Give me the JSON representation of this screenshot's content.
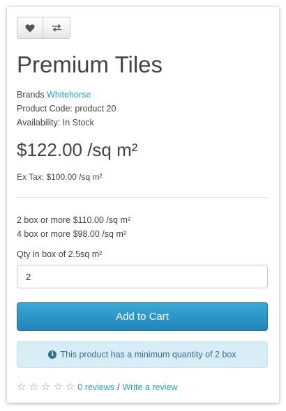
{
  "product": {
    "title": "Premium Tiles",
    "brand_label": "Brands",
    "brand": "Whitehorse",
    "product_code": "Product Code: product 20",
    "availability": "Availability: In Stock",
    "price": "$122.00 /sq m²",
    "ex_tax": "Ex Tax: $100.00 /sq m²"
  },
  "discounts": [
    "2 box or more $110.00 /sq m²",
    "4 box or more $98.00 /sq m²"
  ],
  "quantity": {
    "label": "Qty in box of 2.5sq m²",
    "value": "2"
  },
  "cart": {
    "add_label": "Add to Cart"
  },
  "alert": {
    "message": "This product has a minimum quantity of 2 box"
  },
  "rating": {
    "stars": 0,
    "reviews_link": "0 reviews",
    "separator": "/",
    "write_link": "Write a review"
  },
  "icons": {
    "wishlist": "heart-icon",
    "compare": "exchange-icon",
    "info": "info-circle-icon",
    "star": "star-outline-icon"
  },
  "colors": {
    "link": "#23a1d1",
    "primary_button": "#2a8fc4",
    "alert_background": "#d9edf7",
    "alert_text": "#31708f"
  }
}
